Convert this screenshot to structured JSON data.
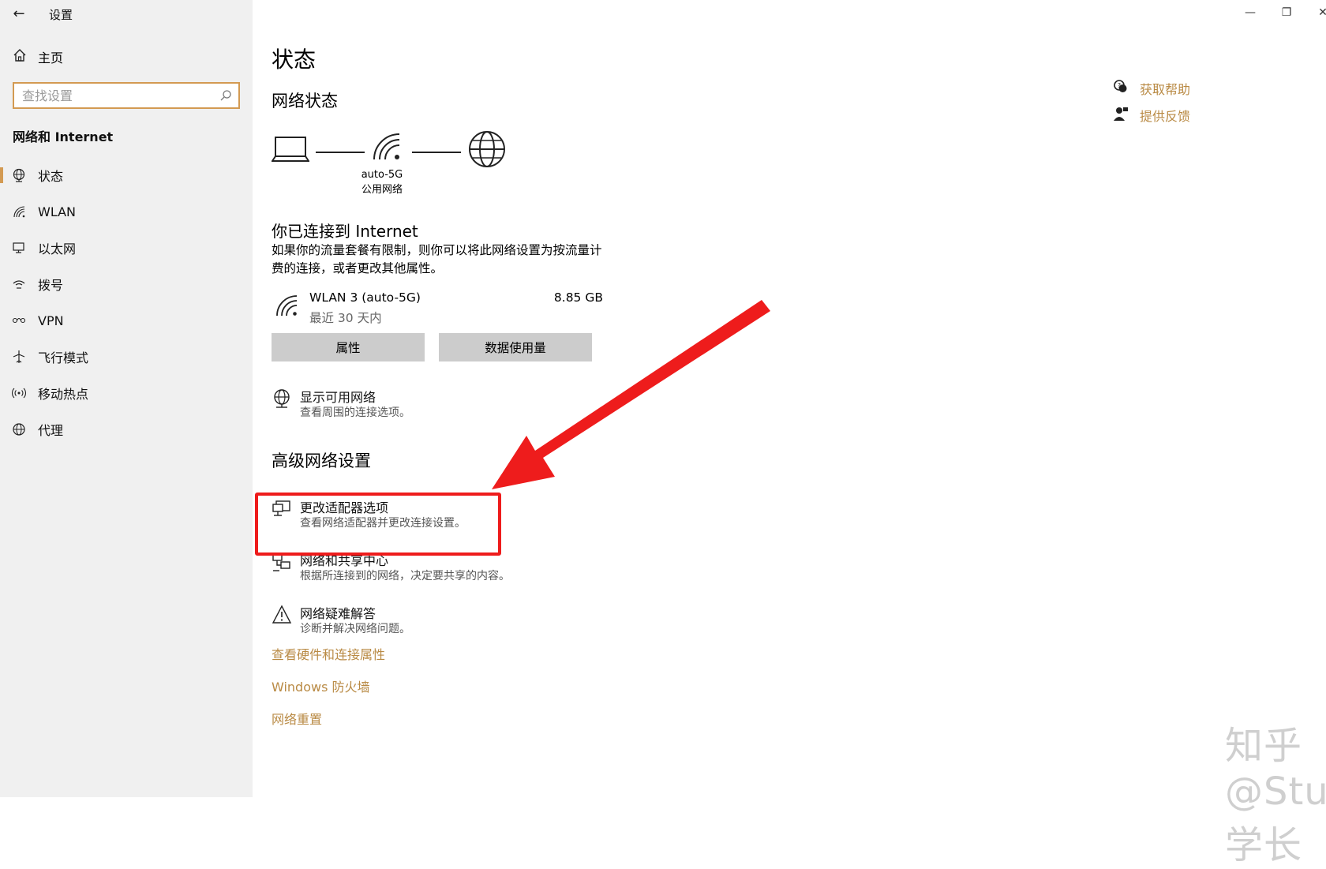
{
  "window": {
    "title": "设置",
    "minimize": "—",
    "restore": "❐",
    "close": "✕"
  },
  "sidebar": {
    "home_label": "主页",
    "search_placeholder": "查找设置",
    "category": "网络和 Internet",
    "items": [
      {
        "label": "状态",
        "icon": "globe-status-icon",
        "selected": true
      },
      {
        "label": "WLAN",
        "icon": "wifi-icon",
        "selected": false
      },
      {
        "label": "以太网",
        "icon": "ethernet-icon",
        "selected": false
      },
      {
        "label": "拨号",
        "icon": "dialup-icon",
        "selected": false
      },
      {
        "label": "VPN",
        "icon": "vpn-icon",
        "selected": false
      },
      {
        "label": "飞行模式",
        "icon": "airplane-icon",
        "selected": false
      },
      {
        "label": "移动热点",
        "icon": "hotspot-icon",
        "selected": false
      },
      {
        "label": "代理",
        "icon": "globe-icon",
        "selected": false
      }
    ]
  },
  "main": {
    "title": "状态",
    "network_status_heading": "网络状态",
    "diagram": {
      "network_name": "auto-5G",
      "network_type": "公用网络"
    },
    "connected_title": "你已连接到 Internet",
    "connected_desc": "如果你的流量套餐有限制，则你可以将此网络设置为按流量计费的连接，或者更改其他属性。",
    "adapter": {
      "name": "WLAN 3 (auto-5G)",
      "period": "最近 30 天内",
      "usage": "8.85 GB"
    },
    "buttons": {
      "properties": "属性",
      "data_usage": "数据使用量"
    },
    "show_networks": {
      "title": "显示可用网络",
      "sub": "查看周围的连接选项。"
    },
    "advanced_heading": "高级网络设置",
    "advanced_items": [
      {
        "title": "更改适配器选项",
        "sub": "查看网络适配器并更改连接设置。"
      },
      {
        "title": "网络和共享中心",
        "sub": "根据所连接到的网络，决定要共享的内容。"
      },
      {
        "title": "网络疑难解答",
        "sub": "诊断并解决网络问题。"
      }
    ],
    "links": [
      "查看硬件和连接属性",
      "Windows 防火墙",
      "网络重置"
    ]
  },
  "help": {
    "get_help": "获取帮助",
    "feedback": "提供反馈"
  },
  "watermark": "知乎 @Study 学长",
  "colors": {
    "accent": "#d39a52",
    "link": "#b98a44",
    "annotation": "#ee1c1c"
  }
}
